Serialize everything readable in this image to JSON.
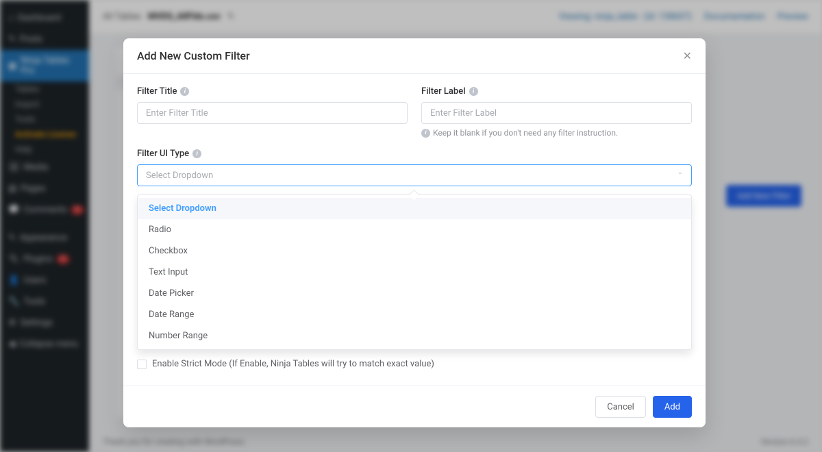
{
  "bg": {
    "sidebar": {
      "dashboard": "Dashboard",
      "posts": "Posts",
      "ninja_tables": "Ninja Tables Pro",
      "sub": [
        "Tables",
        "Import",
        "Tools",
        "Activate License",
        "Help"
      ],
      "media": "Media",
      "pages": "Pages",
      "comments": "Comments",
      "comments_badge": "1",
      "appearance": "Appearance",
      "plugins": "Plugins",
      "plugins_badge": "1",
      "users": "Users",
      "tools": "Tools",
      "settings": "Settings",
      "collapse": "Collapse menu"
    },
    "topbar": {
      "all_tables": "All Tables",
      "table_name": "MVDS_AllFlds.csv",
      "viewing": "Viewing: ninja_table - (id: 138607)",
      "docs": "Documentation",
      "preview": "Preview"
    },
    "addbtn": "Add New Filter",
    "footer_left": "Thank you for creating with WordPress.",
    "footer_right": "Version 6.4.2"
  },
  "modal": {
    "title": "Add New Custom Filter",
    "labels": {
      "filter_title": "Filter Title",
      "filter_label": "Filter Label",
      "filter_ui_type": "Filter UI Type"
    },
    "placeholders": {
      "filter_title": "Enter Filter Title",
      "filter_label": "Enter Filter Label",
      "filter_ui_type": "Select Dropdown"
    },
    "helper_label": "Keep it blank if you don't need any filter instruction.",
    "dropdown_options": [
      "Select Dropdown",
      "Radio",
      "Checkbox",
      "Text Input",
      "Date Picker",
      "Date Range",
      "Number Range"
    ],
    "strict_mode": "Enable Strict Mode (If Enable, Ninja Tables will try to match exact value)",
    "cancel": "Cancel",
    "add": "Add"
  }
}
